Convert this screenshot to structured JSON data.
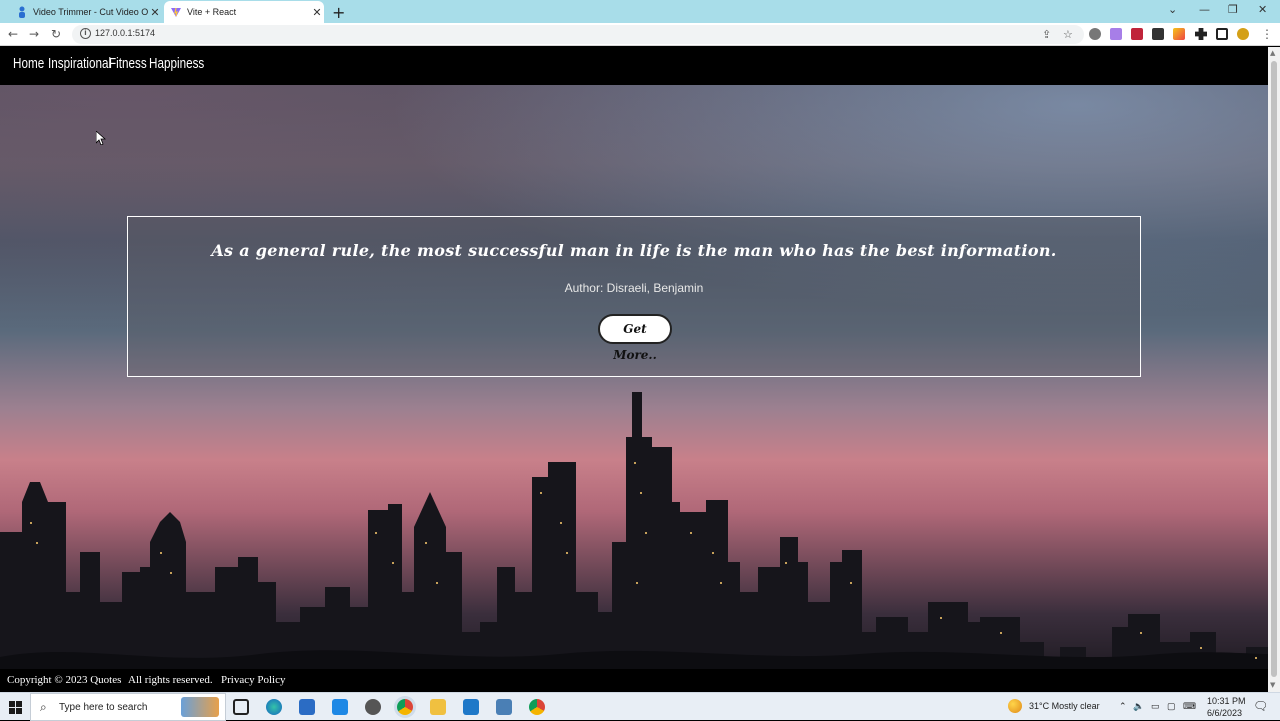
{
  "browser": {
    "tabs": [
      {
        "title": "Video Trimmer - Cut Video Onlin",
        "active": false
      },
      {
        "title": "Vite + React",
        "active": true
      }
    ],
    "url": "127.0.0.1:5174",
    "window_controls": {
      "minimize": "—",
      "restore": "❐",
      "close": "✕"
    }
  },
  "page": {
    "nav": [
      "Home",
      "Inspirational",
      "Fitness",
      "Happiness"
    ],
    "quote": {
      "text": "As a general rule, the most successful man in life is the man who has the best information.",
      "author_line": "Author: Disraeli, Benjamin",
      "button_label": "Get More.."
    },
    "footer": {
      "copyright": "Copyright © 2023 Quotes",
      "rights": "All rights reserved.",
      "privacy": "Privacy Policy"
    }
  },
  "taskbar": {
    "search_placeholder": "Type here to search",
    "weather": "31°C  Mostly clear",
    "time": "10:31 PM",
    "date": "6/6/2023"
  },
  "colors": {
    "chrome_tabstrip": "#a8dde9",
    "nav_bg": "#000000",
    "card_border": "#ffffff"
  }
}
